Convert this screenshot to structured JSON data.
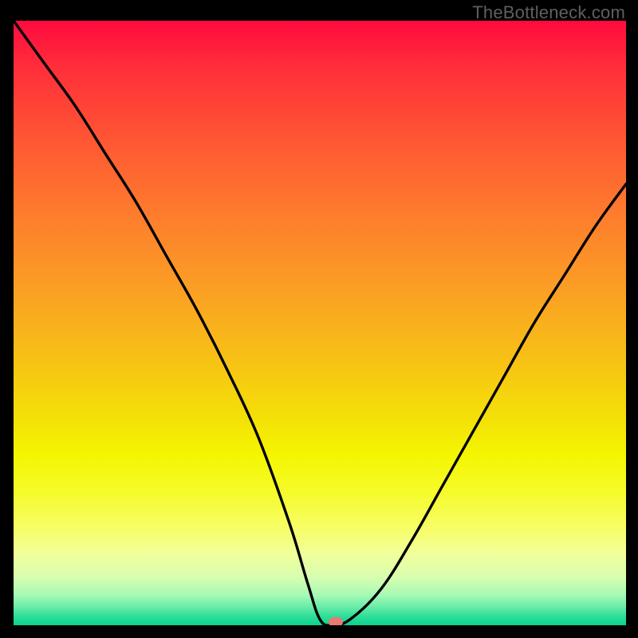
{
  "watermark": "TheBottleneck.com",
  "marker": {
    "x_pct": 52.6,
    "y_pct": 99.5,
    "color": "#e77a72"
  },
  "chart_data": {
    "type": "line",
    "title": "",
    "xlabel": "",
    "ylabel": "",
    "xlim": [
      0,
      100
    ],
    "ylim": [
      0,
      100
    ],
    "grid": false,
    "series": [
      {
        "name": "bottleneck-curve",
        "x": [
          0,
          5,
          10,
          15,
          20,
          25,
          30,
          35,
          40,
          45,
          48,
          50,
          52,
          55,
          60,
          65,
          70,
          75,
          80,
          85,
          90,
          95,
          100
        ],
        "y": [
          100,
          93,
          86,
          78,
          70,
          61,
          52,
          42,
          31,
          17,
          7,
          1,
          0,
          1,
          6,
          14,
          23,
          32,
          41,
          50,
          58,
          66,
          73
        ]
      }
    ],
    "annotations": [
      {
        "type": "marker",
        "x": 52.6,
        "y": 0.5,
        "shape": "pill",
        "color": "#e77a72"
      }
    ],
    "background": {
      "type": "vertical-gradient",
      "stops": [
        {
          "pct": 0,
          "color": "#ff0a3e"
        },
        {
          "pct": 20,
          "color": "#ff5733"
        },
        {
          "pct": 44,
          "color": "#fb9e25"
        },
        {
          "pct": 66,
          "color": "#f4e107"
        },
        {
          "pct": 88,
          "color": "#f2ff99"
        },
        {
          "pct": 100,
          "color": "#07d38e"
        }
      ]
    }
  }
}
